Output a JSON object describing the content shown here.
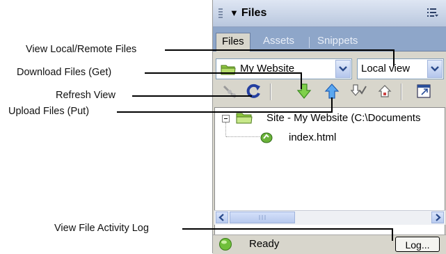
{
  "callouts": {
    "view_local_remote": "View Local/Remote Files",
    "download": "Download Files (Get)",
    "refresh": "Refresh View",
    "upload": "Upload Files (Put)",
    "activity_log": "View File Activity Log"
  },
  "panel": {
    "title": "Files",
    "tabs": [
      "Files",
      "Assets",
      "Snippets"
    ],
    "site_select": "My Website",
    "view_select": "Local view",
    "tree": {
      "root_label": "Site - My Website (C:\\Documents",
      "file_label": "index.html"
    },
    "status": "Ready",
    "log_button": "Log..."
  },
  "colors": {
    "titlebar": "#c9d4e8",
    "tabstrip": "#8ea6c9",
    "panel_bg": "#d8d6cc"
  }
}
